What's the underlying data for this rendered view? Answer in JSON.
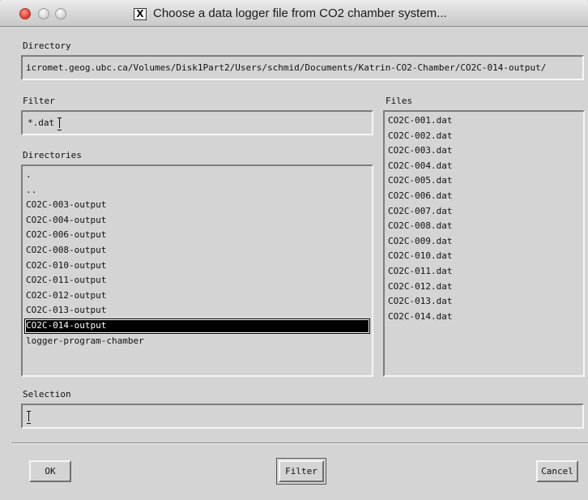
{
  "window": {
    "title": "Choose a data logger file from CO2 chamber system...",
    "x11_badge": "X"
  },
  "directory": {
    "label": "Directory",
    "value": "icromet.geog.ubc.ca/Volumes/Disk1Part2/Users/schmid/Documents/Katrin-CO2-Chamber/CO2C-014-output/"
  },
  "filter": {
    "label": "Filter",
    "value": "*.dat"
  },
  "directories": {
    "label": "Directories",
    "items": [
      ".",
      "..",
      "CO2C-003-output",
      "CO2C-004-output",
      "CO2C-006-output",
      "CO2C-008-output",
      "CO2C-010-output",
      "CO2C-011-output",
      "CO2C-012-output",
      "CO2C-013-output",
      "CO2C-014-output",
      "logger-program-chamber"
    ],
    "selected": "CO2C-014-output"
  },
  "files": {
    "label": "Files",
    "items": [
      "CO2C-001.dat",
      "CO2C-002.dat",
      "CO2C-003.dat",
      "CO2C-004.dat",
      "CO2C-005.dat",
      "CO2C-006.dat",
      "CO2C-007.dat",
      "CO2C-008.dat",
      "CO2C-009.dat",
      "CO2C-010.dat",
      "CO2C-011.dat",
      "CO2C-012.dat",
      "CO2C-013.dat",
      "CO2C-014.dat"
    ]
  },
  "selection": {
    "label": "Selection",
    "value": ""
  },
  "buttons": {
    "ok": "OK",
    "filter": "Filter",
    "cancel": "Cancel"
  }
}
